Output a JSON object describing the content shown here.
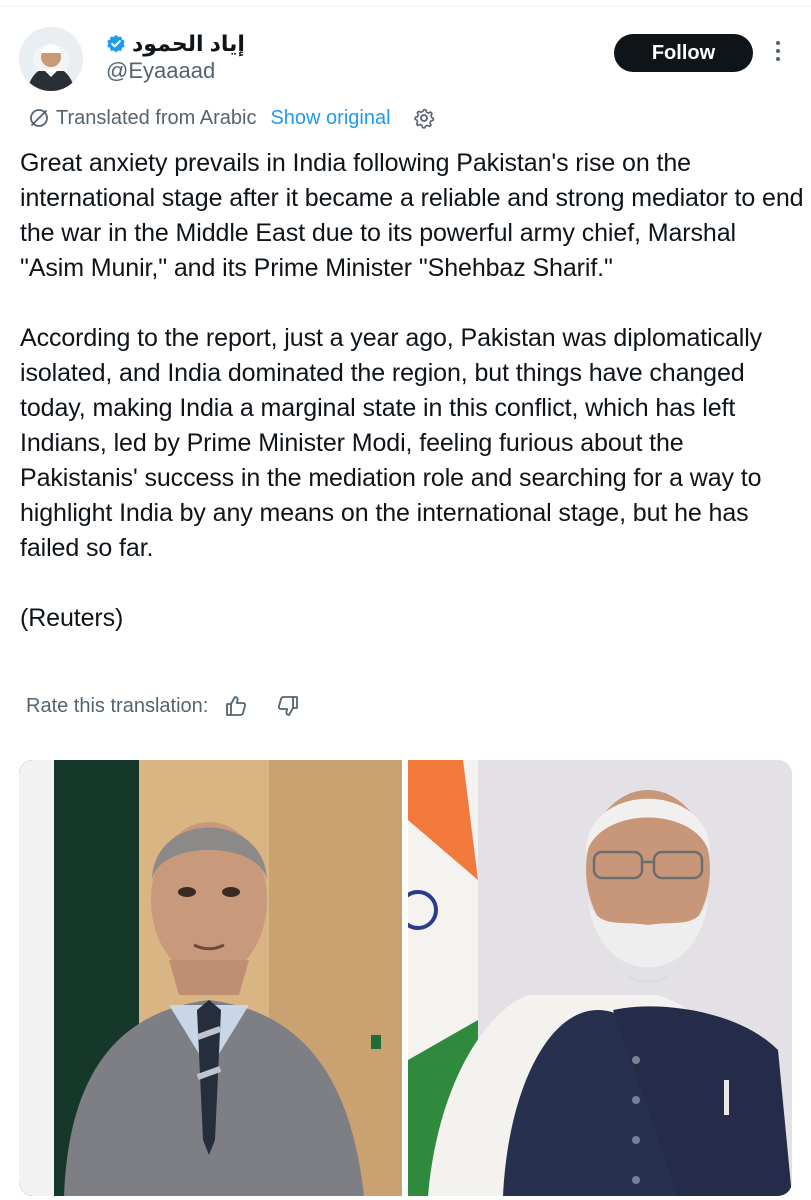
{
  "author": {
    "display_name": "إياد الحمود",
    "handle": "@Eyaaaad",
    "avatar_icon": "profile-photo"
  },
  "actions": {
    "follow_label": "Follow",
    "more_icon": "more-vertical-icon"
  },
  "translation": {
    "label": "Translated from Arabic",
    "show_original": "Show original",
    "settings_icon": "gear-icon"
  },
  "tweet": {
    "text": "Great anxiety prevails in India following Pakistan's rise on the international stage after it became a reliable and strong mediator to end the war in the Middle East due to its powerful army chief, Marshal \"Asim Munir,\" and its Prime Minister \"Shehbaz Sharif.\"\n\nAccording to the report, just a year ago, Pakistan was diplomatically isolated, and India dominated the region, but things have changed today, making India a marginal state in this conflict, which has left Indians, led by Prime Minister Modi, feeling furious about the Pakistanis' success in the mediation role and searching for a way to highlight India by any means on the international stage, but he has failed so far.\n\n(Reuters)"
  },
  "rate": {
    "label": "Rate this translation:",
    "up_icon": "thumbs-up-icon",
    "down_icon": "thumbs-down-icon"
  },
  "media": [
    {
      "subject": "man in grey suit before Pakistan flag"
    },
    {
      "subject": "man with white beard before India flag"
    }
  ],
  "colors": {
    "accent": "#1d9bf0",
    "text": "#0f1419",
    "secondary": "#536471",
    "button": "#0f1419"
  }
}
